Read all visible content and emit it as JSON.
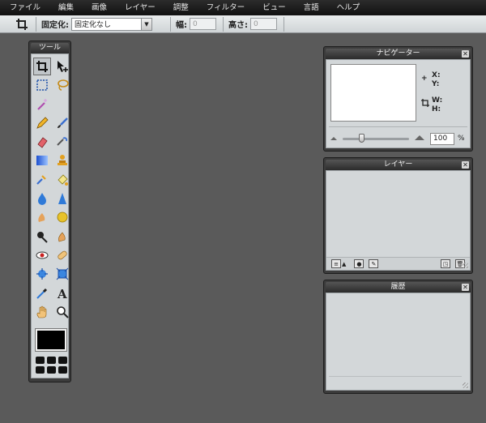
{
  "menu": [
    "ファイル",
    "編集",
    "画像",
    "レイヤー",
    "調整",
    "フィルター",
    "ビュー",
    "言語",
    "ヘルプ"
  ],
  "options": {
    "tool_icon": "crop-icon",
    "constraint_label": "固定化:",
    "constraint_value": "固定化なし",
    "width_label": "幅:",
    "width_value": "0",
    "height_label": "高さ:",
    "height_value": "0"
  },
  "tools_panel": {
    "title": "ツール",
    "tools": [
      "crop-icon",
      "move-icon",
      "marquee-icon",
      "lasso-icon",
      "magic-wand-icon",
      "blank",
      "pencil-icon",
      "brush-icon",
      "eraser-icon",
      "replace-color-icon",
      "gradient-icon",
      "stamp-icon",
      "color-replace-icon",
      "paint-bucket-icon",
      "blur-icon",
      "sharpen-icon",
      "smudge-icon",
      "sponge-icon",
      "dodge-icon",
      "burn-icon",
      "red-eye-icon",
      "spot-heal-icon",
      "bloat-icon",
      "pinch-icon",
      "color-picker-icon",
      "type-icon",
      "hand-icon",
      "zoom-icon"
    ],
    "color": "#000000"
  },
  "navigator": {
    "title": "ナビゲーター",
    "x_label": "X:",
    "y_label": "Y:",
    "w_label": "W:",
    "h_label": "H:",
    "zoom": "100",
    "zoom_unit": "%"
  },
  "layers": {
    "title": "レイヤー"
  },
  "history": {
    "title": "履歴"
  }
}
